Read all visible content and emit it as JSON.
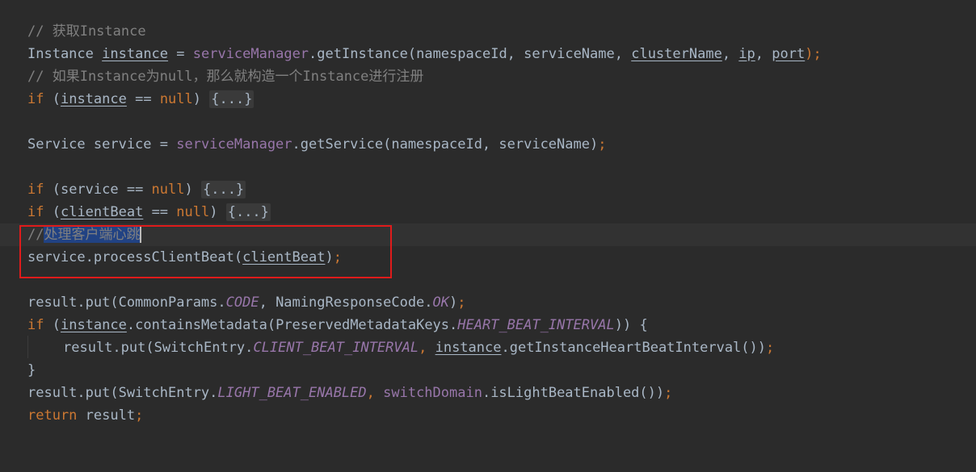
{
  "code": {
    "l1": {
      "comment": "// 获取Instance"
    },
    "l2": {
      "type": "Instance",
      "var": "instance",
      "eq": " = ",
      "mgr": "serviceManager",
      "call": ".getInstance(namespaceId, serviceName, ",
      "a1": "clusterName",
      "sep1": ", ",
      "a2": "ip",
      "sep2": ", ",
      "a3": "port",
      "end": ");"
    },
    "l3": {
      "comment": "// 如果Instance为null，那么就构造一个Instance进行注册"
    },
    "l4": {
      "kw": "if",
      "open": " (",
      "var": "instance",
      "op": " == ",
      "nul": "null",
      "close": ") ",
      "fold": "{...}"
    },
    "l6": {
      "text": "Service service = ",
      "mgr": "serviceManager",
      "call": ".getService(namespaceId, serviceName)",
      "semi": ";"
    },
    "l8": {
      "kw": "if",
      "mid": " (service == ",
      "nul": "null",
      "close": ") ",
      "fold": "{...}"
    },
    "l9": {
      "kw": "if",
      "open": " (",
      "var": "clientBeat",
      "op": " == ",
      "nul": "null",
      "close": ") ",
      "fold": "{...}"
    },
    "l10": {
      "slashes": "//",
      "selected": "处理客户端心跳"
    },
    "l11": {
      "pre": "service.processClientBeat(",
      "var": "clientBeat",
      "end": ")",
      "semi": ";"
    },
    "l13": {
      "pre": "result.put(CommonParams.",
      "const": "CODE",
      "mid": ", NamingResponseCode.",
      "const2": "OK",
      "end": ")",
      "semi": ";"
    },
    "l14": {
      "kw": "if",
      "open": " (",
      "var": "instance",
      "mid": ".containsMetadata(PreservedMetadataKeys.",
      "const": "HEART_BEAT_INTERVAL",
      "end": ")) {"
    },
    "l15": {
      "pre": "result.put(SwitchEntry.",
      "const": "CLIENT_BEAT_INTERVAL",
      "comma": ", ",
      "var": "instance",
      "end": ".getInstanceHeartBeatInterval())",
      "semi": ";"
    },
    "l16": {
      "text": "}"
    },
    "l17": {
      "pre": "result.put(SwitchEntry.",
      "const": "LIGHT_BEAT_ENABLED",
      "comma": ", ",
      "field": "switchDomain",
      "end": ".isLightBeatEnabled())",
      "semi": ";"
    },
    "l18": {
      "kw": "return",
      "rest": " result",
      "semi": ";"
    }
  },
  "colors": {
    "background": "#2b2b2b",
    "keyword": "#cc7832",
    "field": "#9876aa",
    "comment": "#808080",
    "text": "#a9b7c6",
    "selection": "#214283",
    "annotation_box": "#e01b1b"
  }
}
